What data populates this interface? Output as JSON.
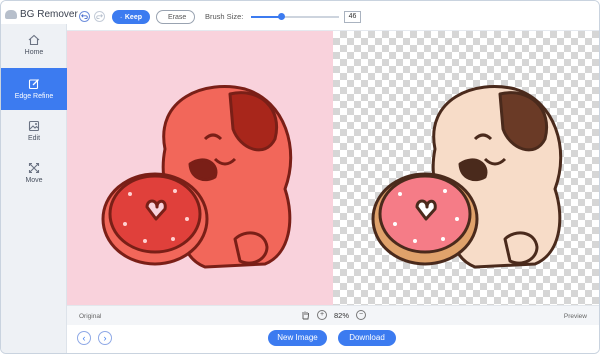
{
  "window": {
    "title": "BG Remover"
  },
  "toolbar": {
    "keep_label": "Keep",
    "erase_label": "Erase",
    "brush_size_label": "Brush Size:",
    "brush_size_value": "46",
    "brush_size_fraction": 0.35
  },
  "sidebar": {
    "items": [
      {
        "label": "Home",
        "icon": "home-icon",
        "active": false
      },
      {
        "label": "Edge Refine",
        "icon": "edge-refine-icon",
        "active": true
      },
      {
        "label": "Edit",
        "icon": "edit-image-icon",
        "active": false
      },
      {
        "label": "Move",
        "icon": "move-icon",
        "active": false
      }
    ]
  },
  "canvas": {
    "original_bg": "#f9d2dc",
    "pup_left_color": "#f2675a",
    "pup_right_color": "#f7dcc8",
    "donut_color": "#f57c87"
  },
  "statusbar": {
    "left_label": "Original",
    "right_label": "Preview",
    "zoom_value": "82%"
  },
  "footer": {
    "new_image_label": "New Image",
    "download_label": "Download"
  },
  "colors": {
    "accent": "#3c7bf0"
  }
}
